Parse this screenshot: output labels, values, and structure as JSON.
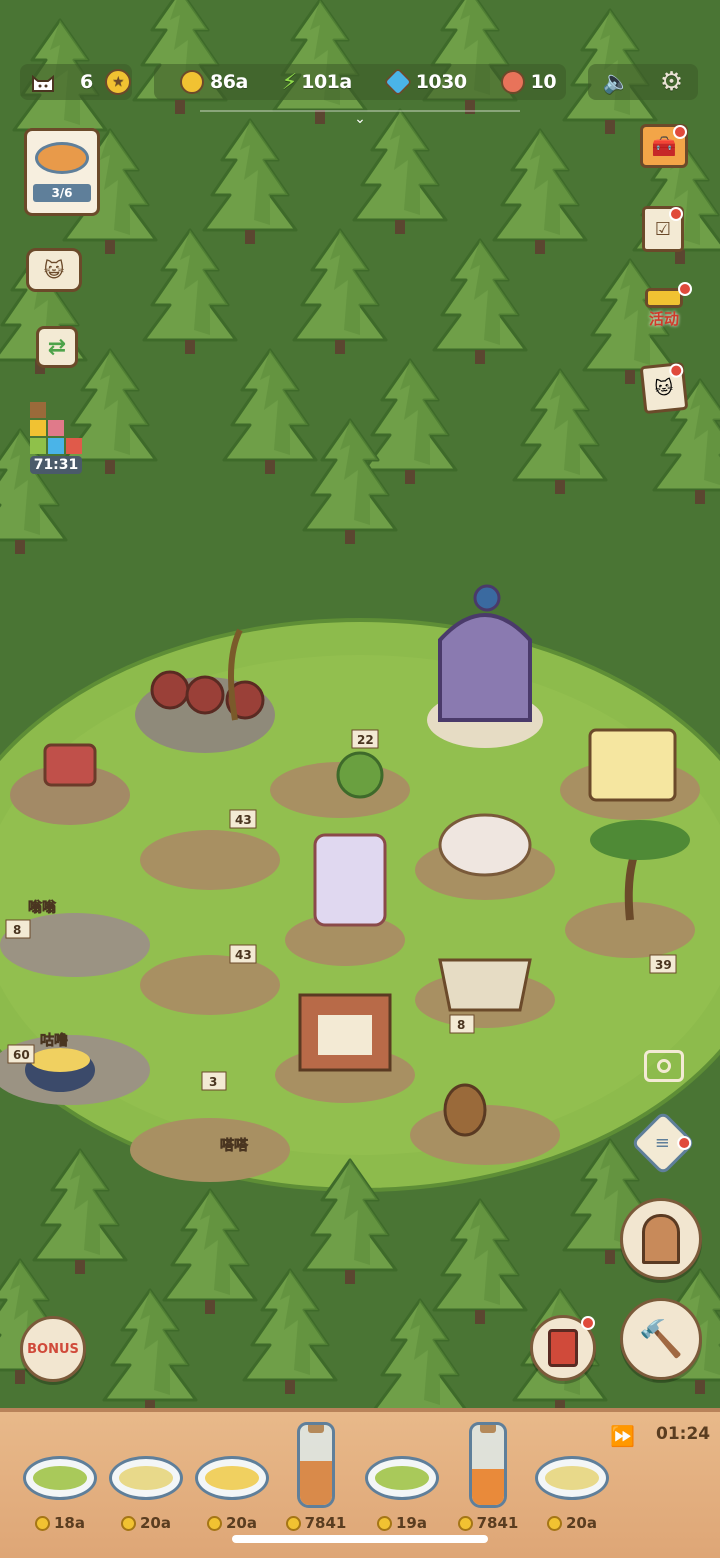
{
  "hud": {
    "cat_count": "6",
    "coins": "86a",
    "energy": "101a",
    "gems": "1030",
    "tickets": "10"
  },
  "left_panel": {
    "recipe_progress": "3/6",
    "timer": "71:31"
  },
  "right_panel": {
    "event_label": "活动"
  },
  "tray": {
    "timer": "01:24",
    "items": [
      {
        "kind": "dish",
        "food_color": "#a9c95a",
        "price": "18a"
      },
      {
        "kind": "dish",
        "food_color": "#e8d98a",
        "price": "20a"
      },
      {
        "kind": "dish",
        "food_color": "#f0d060",
        "price": "20a"
      },
      {
        "kind": "bottle",
        "liquid_color": "#d98a4a",
        "fill": 0.55,
        "price": "7841"
      },
      {
        "kind": "dish",
        "food_color": "#a9c95a",
        "price": "19a"
      },
      {
        "kind": "bottle",
        "liquid_color": "#e98a3a",
        "fill": 0.45,
        "price": "7841"
      },
      {
        "kind": "dish",
        "food_color": "#e8d98a",
        "price": "20a"
      }
    ]
  },
  "stations": {
    "sign_22": "22",
    "sign_43a": "43",
    "sign_43b": "43",
    "sign_8a": "8",
    "sign_8b": "8",
    "sign_39": "39",
    "sign_60": "60",
    "sign_3": "3",
    "bubble_1": "嗡嗡",
    "bubble_2": "咕噜",
    "bubble_3": "嗒嗒"
  },
  "colors": {
    "forest_dark": "#3f6a2d",
    "tree": "#6a9a45",
    "grass": "#8fb84a",
    "tray": "#dea676"
  }
}
